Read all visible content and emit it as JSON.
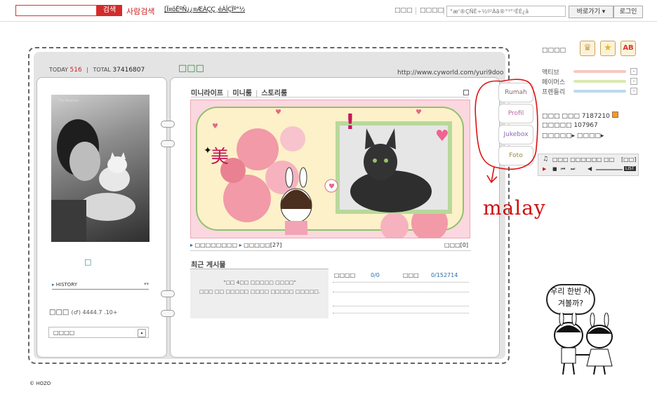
{
  "topbar": {
    "search_button": "검색",
    "people_search": "사람검색",
    "garbled_link": "[Ï¤ôËºÑ¿¿¤ÆÀÇÇ¸éÀÎÇÏº°½",
    "menu1": "□□□",
    "menu2": "□□□□",
    "menu3": "□□□",
    "quick_search_text": "°æ'®ÇÑË÷½º²Àã®°³°¹ËÉ¿â",
    "goto_label": "바로가기 ▾",
    "login_label": "로그인"
  },
  "header": {
    "today_label": "TODAY",
    "today_value": "516",
    "total_label": "TOTAL",
    "total_value": "37416807",
    "title": "□□□",
    "url": "http://www.cyworld.com/yuri9doo"
  },
  "left": {
    "photo_caption": "The Beatles",
    "mini_text": "□",
    "history_label": "HISTORY",
    "name": "□□□",
    "name_detail": "(♂)  4444.7 .10+",
    "select_label": "□□□□"
  },
  "nav": {
    "items": [
      "미니라이프",
      "미니룸",
      "스토리룸"
    ]
  },
  "banner": {
    "mi_char": "美",
    "exclaim": "!"
  },
  "links": {
    "left1": "□□□□□□□□",
    "left2": "□□□□□[27]",
    "right": "□□□[0]"
  },
  "recent": {
    "title": "최근 게시물",
    "line1": "\"□□ 4□□ □□□□□ □□□□\"",
    "line2": "□□□ □□ □□□□□ □□□□ □□□□□ □□□□□."
  },
  "stats": {
    "label1": "□□□□",
    "value1": "0/0",
    "label2": "□□□",
    "value2": "0/152714"
  },
  "sidebar": {
    "title": "□□□□",
    "bars": [
      {
        "label": "액티브",
        "color": "#f5c9c0"
      },
      {
        "label": "페이머스",
        "color": "#dbe8b0"
      },
      {
        "label": "프렌들리",
        "color": "#bcdbe8"
      }
    ],
    "info1_label": "□□□ □□□",
    "info1_value": "7187210",
    "info2_label": "□□□□□",
    "info2_value": "107967",
    "link_text": "□□□□□▸ □□□□▸",
    "player_title": "□□□ □□□□□□ □□",
    "player_tag": "[□□]",
    "list_label": "LIST",
    "tabs": [
      "Rumah",
      "Profil",
      "Jukebox",
      "Foto"
    ]
  },
  "annotation": {
    "scribble_text": "malay",
    "speech": "우리 한번 사겨볼까?"
  },
  "footer": {
    "copyright": "© HOZO"
  }
}
